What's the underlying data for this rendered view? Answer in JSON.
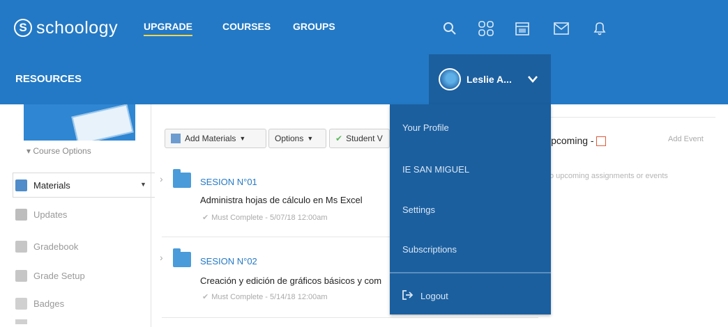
{
  "header": {
    "logo_text": "schoology",
    "nav": [
      "UPGRADE",
      "COURSES",
      "GROUPS"
    ],
    "icons": [
      "search-icon",
      "grid-icon",
      "calendar-icon",
      "mail-icon",
      "bell-icon"
    ]
  },
  "subheader": {
    "title": "RESOURCES",
    "user_name": "Leslie A..."
  },
  "user_menu": {
    "items": [
      "Your Profile",
      "IE SAN MIGUEL",
      "Settings",
      "Subscriptions"
    ],
    "logout": "Logout"
  },
  "sidebar": {
    "course_options": "Course Options",
    "items": [
      "Materials",
      "Updates",
      "Gradebook",
      "Grade Setup",
      "Badges"
    ]
  },
  "toolbar": {
    "add_materials": "Add Materials",
    "options": "Options",
    "student_view": "Student V"
  },
  "materials": [
    {
      "title": "SESION N°01",
      "description": "Administra hojas de cálculo en Ms Excel",
      "meta": "Must Complete - 5/07/18 12:00am"
    },
    {
      "title": "SESION N°02",
      "description": "Creación y edición de gráficos básicos y com",
      "meta": "Must Complete - 5/14/18 12:00am"
    }
  ],
  "upcoming": {
    "title": "Upcoming",
    "add_event": "Add Event",
    "empty": "No upcoming assignments or events"
  },
  "colors": {
    "brand_blue": "#2379c5",
    "menu_blue": "#1b5f9f",
    "nav_underline": "#f7d54b"
  }
}
